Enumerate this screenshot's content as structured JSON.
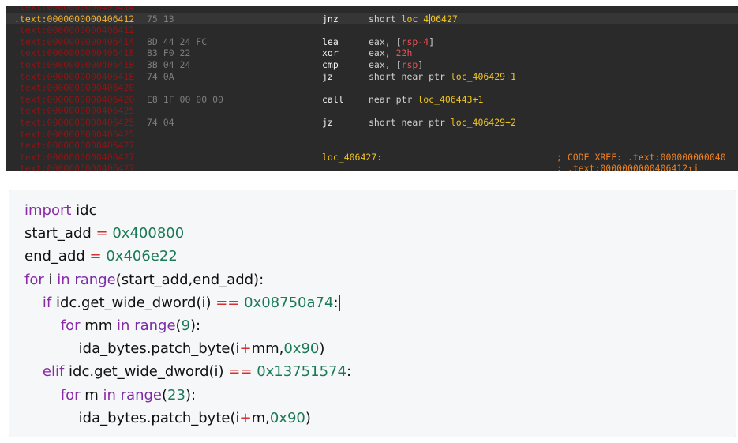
{
  "ida_view": {
    "lines": [
      {
        "addr": ".text:0000000000406414",
        "partial": true
      },
      {
        "addr": ".text:0000000000406412",
        "bytes": "75 13",
        "mnemonic": "jnz",
        "op_pre": "short ",
        "op_label_a": "loc_4",
        "op_label_b": "06427",
        "selected": true
      },
      {
        "addr": ".text:0000000000406412"
      },
      {
        "addr": ".text:0000000000406414",
        "bytes": "8D 44 24 FC",
        "mnemonic": "lea",
        "op1": "eax, [",
        "op_reg": "rsp",
        "op_num": "-4",
        "op2": "]"
      },
      {
        "addr": ".text:0000000000406418",
        "bytes": "83 F0 22",
        "mnemonic": "xor",
        "op1": "eax, ",
        "op_num": "22h"
      },
      {
        "addr": ".text:000000000040641B",
        "bytes": "3B 04 24",
        "mnemonic": "cmp",
        "op1": "eax, [",
        "op_reg": "rsp",
        "op2": "]"
      },
      {
        "addr": ".text:000000000040641E",
        "bytes": "74 0A",
        "mnemonic": "jz",
        "op_pre": "short near ptr ",
        "op_label": "loc_406429",
        "op_suffix": "+1"
      },
      {
        "addr": ".text:0000000000406420"
      },
      {
        "addr": ".text:0000000000406420",
        "bytes": "E8 1F 00 00 00",
        "mnemonic": "call",
        "op_pre": "near ptr ",
        "op_label": "loc_406443",
        "op_suffix": "+1"
      },
      {
        "addr": ".text:0000000000406425"
      },
      {
        "addr": ".text:0000000000406425",
        "bytes": "74 04",
        "mnemonic": "jz",
        "op_pre": "short near ptr ",
        "op_label": "loc_406429",
        "op_suffix": "+2"
      },
      {
        "addr": ".text:0000000000406425"
      },
      {
        "addr": ".text:0000000000406427"
      },
      {
        "addr": ".text:0000000000406427",
        "label": "loc_406427",
        "label_colon": ":",
        "comment": "; CODE XREF: .text:000000000040"
      },
      {
        "addr": ".text:0000000000406427",
        "comment": "; .text:0000000000406412↑j"
      }
    ]
  },
  "code_block": {
    "lines": [
      {
        "tokens": [
          {
            "t": "import ",
            "c": "kw"
          },
          {
            "t": "idc",
            "c": ""
          }
        ]
      },
      {
        "tokens": [
          {
            "t": "start_add ",
            "c": ""
          },
          {
            "t": "=",
            "c": "op"
          },
          {
            "t": " ",
            "c": ""
          },
          {
            "t": "0x400800",
            "c": "num"
          }
        ]
      },
      {
        "tokens": [
          {
            "t": "end_add ",
            "c": ""
          },
          {
            "t": "=",
            "c": "op"
          },
          {
            "t": " ",
            "c": ""
          },
          {
            "t": "0x406e22",
            "c": "num"
          }
        ]
      },
      {
        "tokens": [
          {
            "t": "for",
            "c": "kw"
          },
          {
            "t": " i ",
            "c": ""
          },
          {
            "t": "in",
            "c": "kw"
          },
          {
            "t": " ",
            "c": ""
          },
          {
            "t": "range",
            "c": "fn"
          },
          {
            "t": "(start_add,end_add):",
            "c": ""
          }
        ]
      },
      {
        "tokens": [
          {
            "t": "    ",
            "c": ""
          },
          {
            "t": "if",
            "c": "kw"
          },
          {
            "t": " idc.get_wide_dword(i) ",
            "c": ""
          },
          {
            "t": "==",
            "c": "op"
          },
          {
            "t": " ",
            "c": ""
          },
          {
            "t": "0x08750a74",
            "c": "num"
          },
          {
            "t": ":",
            "c": "",
            "cursor": true
          }
        ]
      },
      {
        "tokens": [
          {
            "t": "        ",
            "c": ""
          },
          {
            "t": "for",
            "c": "kw"
          },
          {
            "t": " mm ",
            "c": ""
          },
          {
            "t": "in",
            "c": "kw"
          },
          {
            "t": " ",
            "c": ""
          },
          {
            "t": "range",
            "c": "fn"
          },
          {
            "t": "(",
            "c": ""
          },
          {
            "t": "9",
            "c": "num"
          },
          {
            "t": "):",
            "c": ""
          }
        ]
      },
      {
        "tokens": [
          {
            "t": "            ida_bytes.patch_byte(i",
            "c": ""
          },
          {
            "t": "+",
            "c": "op"
          },
          {
            "t": "mm,",
            "c": ""
          },
          {
            "t": "0x90",
            "c": "num"
          },
          {
            "t": ")",
            "c": ""
          }
        ]
      },
      {
        "tokens": [
          {
            "t": "    ",
            "c": ""
          },
          {
            "t": "elif",
            "c": "kw"
          },
          {
            "t": " idc.get_wide_dword(i) ",
            "c": ""
          },
          {
            "t": "==",
            "c": "op"
          },
          {
            "t": " ",
            "c": ""
          },
          {
            "t": "0x13751574",
            "c": "num"
          },
          {
            "t": ":",
            "c": ""
          }
        ]
      },
      {
        "tokens": [
          {
            "t": "        ",
            "c": ""
          },
          {
            "t": "for",
            "c": "kw"
          },
          {
            "t": " m ",
            "c": ""
          },
          {
            "t": "in",
            "c": "kw"
          },
          {
            "t": " ",
            "c": ""
          },
          {
            "t": "range",
            "c": "fn"
          },
          {
            "t": "(",
            "c": ""
          },
          {
            "t": "23",
            "c": "num"
          },
          {
            "t": "):",
            "c": ""
          }
        ]
      },
      {
        "tokens": [
          {
            "t": "            ida_bytes.patch_byte(i",
            "c": ""
          },
          {
            "t": "+",
            "c": "op"
          },
          {
            "t": "m,",
            "c": ""
          },
          {
            "t": "0x90",
            "c": "num"
          },
          {
            "t": ")",
            "c": ""
          }
        ]
      }
    ]
  }
}
